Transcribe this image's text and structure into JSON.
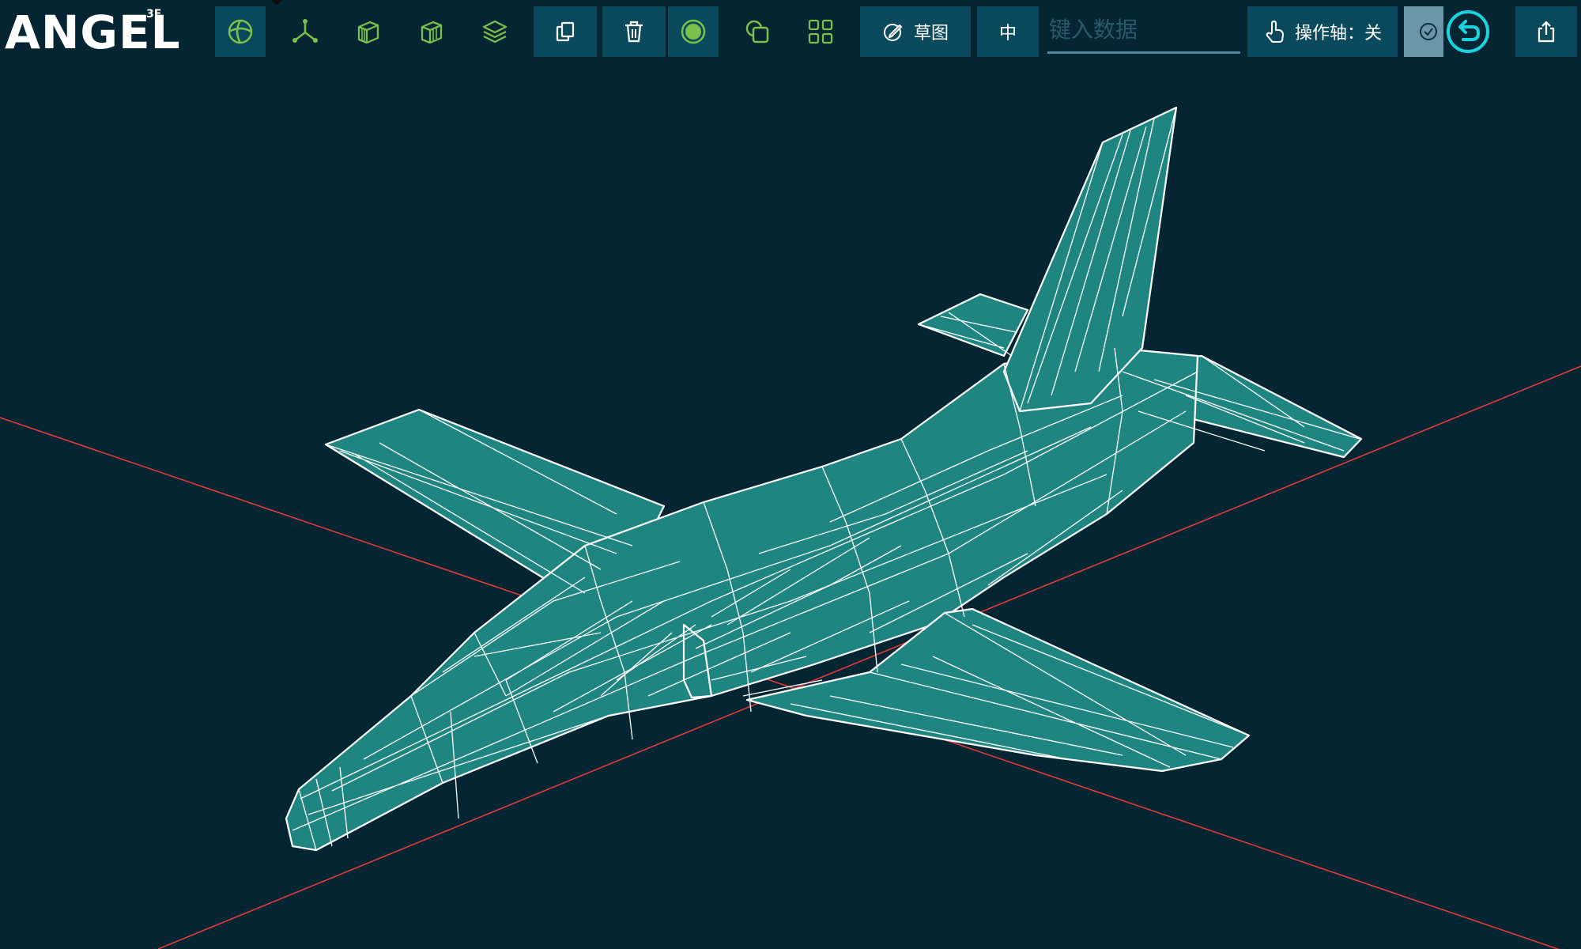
{
  "app": {
    "logo": "ANGEL",
    "logo_sup": "3E"
  },
  "toolbar": {
    "tools": [
      {
        "icon": "globe-icon"
      },
      {
        "icon": "axes-icon"
      },
      {
        "icon": "box-front-icon"
      },
      {
        "icon": "box-side-icon"
      },
      {
        "icon": "layers-icon"
      },
      {
        "icon": "copy-icon"
      },
      {
        "icon": "trash-icon"
      },
      {
        "icon": "record-icon"
      },
      {
        "icon": "shapes-icon"
      },
      {
        "icon": "grid-icon"
      }
    ],
    "sketch_label": "草图",
    "center_label": "中",
    "search_placeholder": "键入数据",
    "axis_toggle_label": "操作轴：关"
  },
  "colors": {
    "background": "#042531",
    "button_bg": "#0b4a5d",
    "icon_green": "#7bc04a",
    "model_fill": "#1f8580",
    "wire": "#ffffff",
    "axis_line": "#e03a3a",
    "accent_cyan": "#18d4e0"
  }
}
